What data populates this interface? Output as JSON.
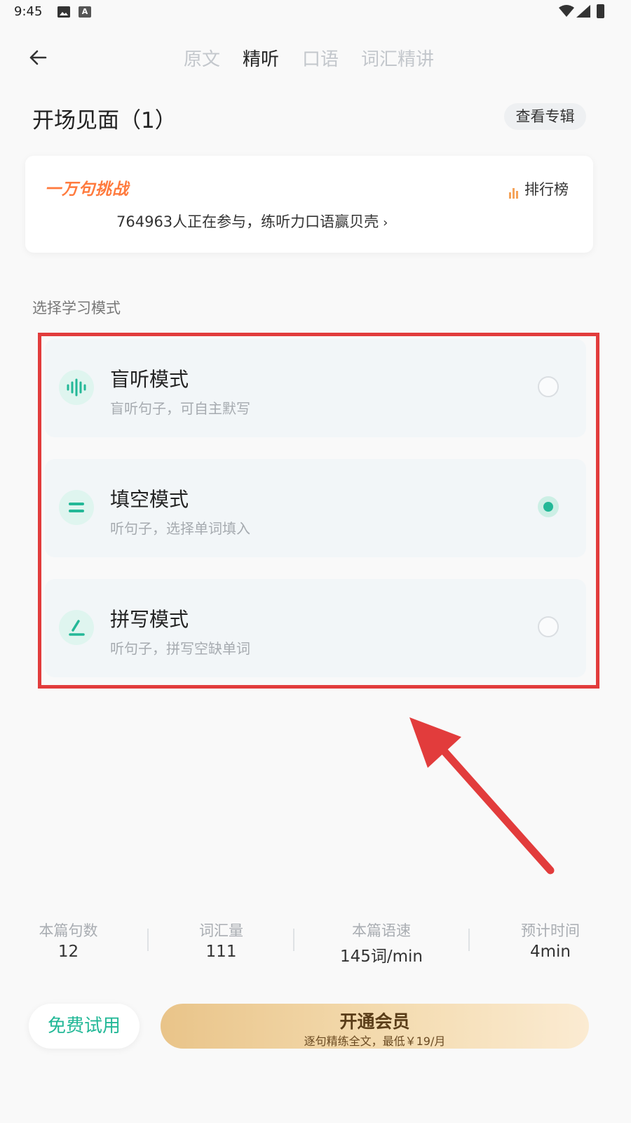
{
  "status_bar": {
    "time": "9:45",
    "a_icon_label": "A",
    "icons": [
      "image-icon",
      "a-letter-icon",
      "wifi-icon",
      "signal-icon",
      "battery-icon"
    ]
  },
  "nav": {
    "tabs": [
      {
        "label": "原文",
        "active": false
      },
      {
        "label": "精听",
        "active": true
      },
      {
        "label": "口语",
        "active": false
      },
      {
        "label": "词汇精讲",
        "active": false
      }
    ]
  },
  "page_title": "开场见面（1）",
  "album_button": "查看专辑",
  "challenge": {
    "logo_text": "一万句挑战",
    "rank_label": "排行榜",
    "participants_text": "764963人正在参与，练听力口语赢贝壳"
  },
  "section_label": "选择学习模式",
  "modes": [
    {
      "title": "盲听模式",
      "desc": "盲听句子，可自主默写",
      "icon": "sound-wave-icon",
      "selected": false
    },
    {
      "title": "填空模式",
      "desc": "听句子，选择单词填入",
      "icon": "equals-icon",
      "selected": true
    },
    {
      "title": "拼写模式",
      "desc": "听句子，拼写空缺单词",
      "icon": "pen-icon",
      "selected": false
    }
  ],
  "stats": [
    {
      "label": "本篇句数",
      "value": "12"
    },
    {
      "label": "词汇量",
      "value": "111"
    },
    {
      "label": "本篇语速",
      "value": "145词/min"
    },
    {
      "label": "预计时间",
      "value": "4min"
    }
  ],
  "buttons": {
    "trial": "免费试用",
    "vip_title": "开通会员",
    "vip_subtitle": "逐句精练全文，最低￥19/月"
  },
  "colors": {
    "accent": "#23b897",
    "highlight": "#e23c3c",
    "challenge_logo": "#ff7a3d",
    "vip_gold": "#e9c489"
  }
}
